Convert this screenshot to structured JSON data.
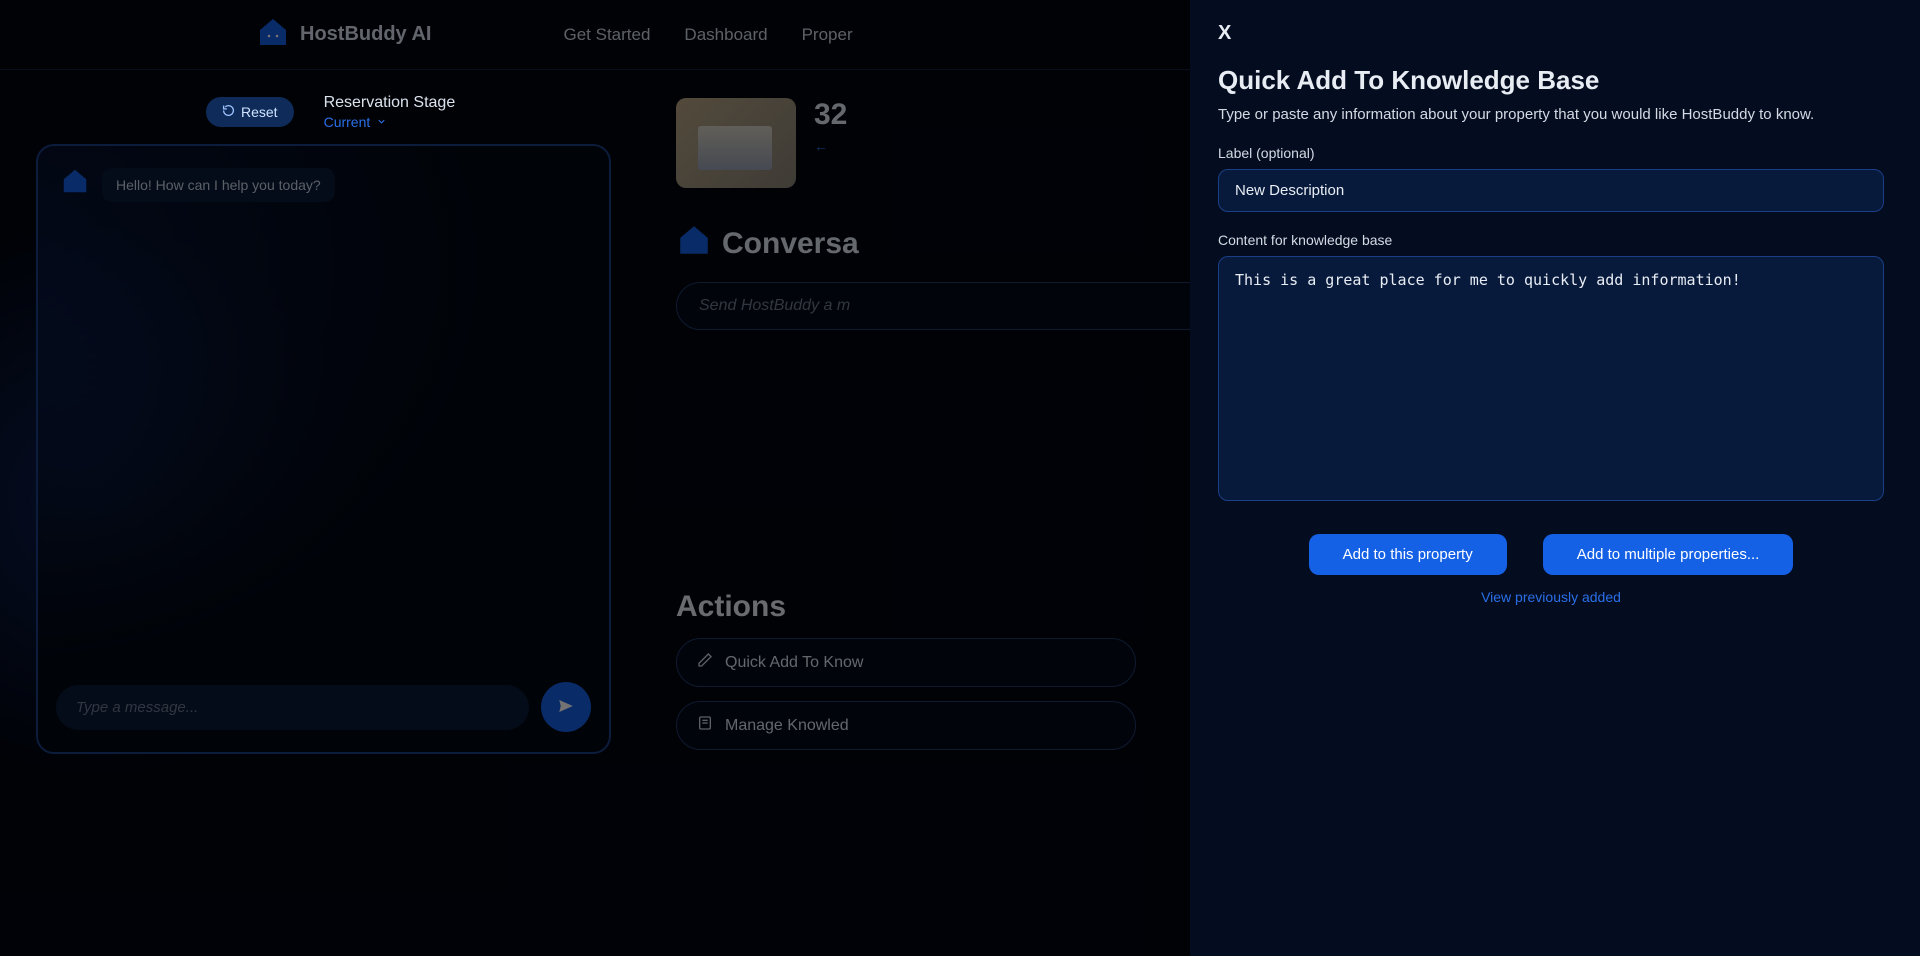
{
  "brand": {
    "name": "HostBuddy AI"
  },
  "nav": {
    "get_started": "Get Started",
    "dashboard": "Dashboard",
    "properties": "Proper"
  },
  "left": {
    "reset": "Reset",
    "stage_label": "Reservation Stage",
    "stage_value": "Current",
    "greeting": "Hello! How can I help you today?",
    "input_placeholder": "Type a message..."
  },
  "right": {
    "property_number_prefix": "32",
    "conversation_heading": "Conversa",
    "send_placeholder": "Send HostBuddy a m",
    "actions_heading": "Actions",
    "action_quick_add": "Quick Add To Know",
    "action_manage": "Manage Knowled"
  },
  "modal": {
    "close": "X",
    "title": "Quick Add To Knowledge Base",
    "subtitle": "Type or paste any information about your property that you would like HostBuddy to know.",
    "label_field": "Label (optional)",
    "label_value": "New Description",
    "content_field": "Content for knowledge base",
    "content_value": "This is a great place for me to quickly add information!",
    "add_single": "Add to this property",
    "add_multi": "Add to multiple properties...",
    "view_prev": "View previously added"
  }
}
